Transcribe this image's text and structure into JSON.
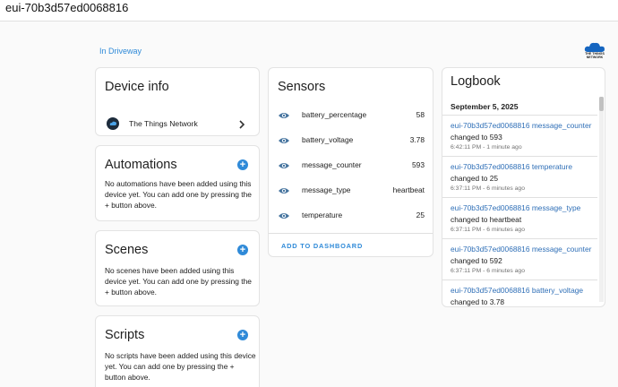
{
  "header": {
    "title": "eui-70b3d57ed0068816"
  },
  "area_link": "In Driveway",
  "brand_logo": {
    "icon": "ttn-cloud-icon",
    "text": "THE THINGS NETWORK"
  },
  "device_info": {
    "title": "Device info",
    "integration": "The Things Network",
    "integration_icon": "ttn-logo-icon"
  },
  "automations": {
    "title": "Automations",
    "empty_text": "No automations have been added using this device yet. You can add one by pressing the + button above."
  },
  "scenes": {
    "title": "Scenes",
    "empty_text": "No scenes have been added using this device yet. You can add one by pressing the + button above."
  },
  "scripts": {
    "title": "Scripts",
    "empty_text": "No scripts have been added using this device yet. You can add one by pressing the + button above."
  },
  "add_symbol": "+",
  "sensors": {
    "title": "Sensors",
    "items": [
      {
        "name": "battery_percentage",
        "value": "58"
      },
      {
        "name": "battery_voltage",
        "value": "3.78"
      },
      {
        "name": "message_counter",
        "value": "593"
      },
      {
        "name": "message_type",
        "value": "heartbeat"
      },
      {
        "name": "temperature",
        "value": "25"
      }
    ],
    "add_to_dashboard": "ADD TO DASHBOARD"
  },
  "logbook": {
    "title": "Logbook",
    "date": "September 5, 2025",
    "entries": [
      {
        "entity": "eui-70b3d57ed0068816 message_counter",
        "change": "changed to 593",
        "time": "6:42:11 PM - 1 minute ago"
      },
      {
        "entity": "eui-70b3d57ed0068816 temperature",
        "change": "changed to 25",
        "time": "6:37:11 PM - 6 minutes ago"
      },
      {
        "entity": "eui-70b3d57ed0068816 message_type",
        "change": "changed to heartbeat",
        "time": "6:37:11 PM - 6 minutes ago"
      },
      {
        "entity": "eui-70b3d57ed0068816 message_counter",
        "change": "changed to 592",
        "time": "6:37:11 PM - 6 minutes ago"
      },
      {
        "entity": "eui-70b3d57ed0068816 battery_voltage",
        "change": "changed to 3.78",
        "time": ""
      }
    ]
  },
  "colors": {
    "accent": "#2f8ad8",
    "link": "#2f6fb7",
    "eye_icon": "#44739e"
  }
}
